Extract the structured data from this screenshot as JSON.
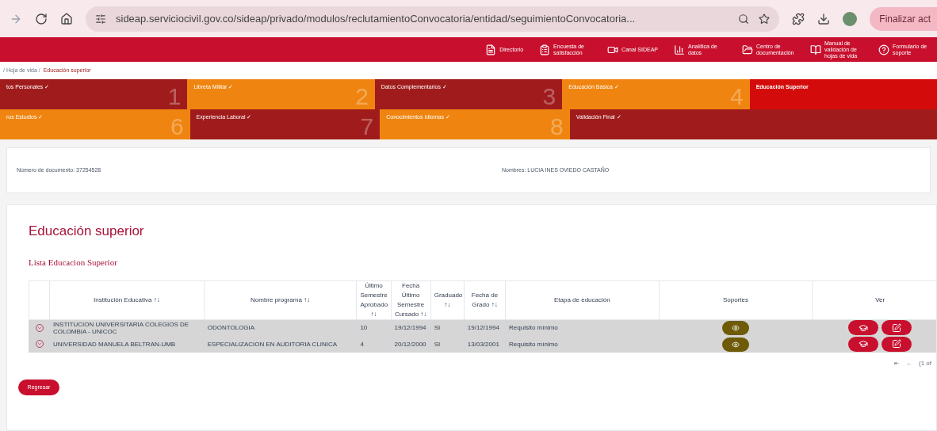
{
  "browser": {
    "url": "sideap.serviciocivil.gov.co/sideap/privado/modulos/reclutamientoConvocatoria/entidad/seguimientoConvocatoria...",
    "action": "Finalizar act"
  },
  "nav": [
    "Directorio",
    "Encuesta de satisfacción",
    "Canal SIDEAP",
    "Analítica de datos",
    "Centro de documentación",
    "Manual de validación de hojas de vida",
    "Formulario de soporte"
  ],
  "breadcrumb": [
    "/ Hoja de vida /",
    "Educación superior"
  ],
  "steps": [
    [
      {
        "label": "tos Personales ✓",
        "number": "1",
        "color": "#a01c1c",
        "selected": false
      },
      {
        "label": "Libreta Militar ✓",
        "number": "2",
        "color": "#ef8510",
        "selected": false
      },
      {
        "label": "Datos Complementarios ✓",
        "number": "3",
        "color": "#a01c1c",
        "selected": false
      },
      {
        "label": "Educación Básica ✓",
        "number": "4",
        "color": "#ef8510",
        "selected": false
      },
      {
        "label": "Educación Superior",
        "color": "#d40b0b",
        "selected": true
      }
    ],
    [
      {
        "label": "ros Estudios ✓",
        "number": "6",
        "color": "#ef8510",
        "selected": false
      },
      {
        "label": "Experiencia Laboral ✓",
        "number": "7",
        "color": "#a01c1c",
        "selected": false
      },
      {
        "label": "Conocimientos Idiomas ✓",
        "number": "8",
        "color": "#ef8510",
        "selected": false
      },
      {
        "label": "Validación Final ✓",
        "color": "#a01c1c",
        "selected": false
      }
    ]
  ],
  "info": [
    "Número de documento: 37254528",
    "Nombres: LUCIA INES OVIEDO CASTAÑO"
  ],
  "section": {
    "title": "Educación superior",
    "subtitle": "Lista Educacion Superior"
  },
  "table": {
    "columns": [
      "Institución Educativa ↑↓",
      "Nombre programa ↑↓",
      "Último Semestre Aprobado ↑↓",
      "Fecha Último Semestre Cursado ↑↓",
      "Graduado ↑↓",
      "Fecha de Grado ↑↓",
      "Etapa de educación",
      "Soportes",
      "Ver"
    ],
    "rows": [
      [
        "INSTITUCION UNIVERSITARIA COLEGIOS DE COLOMBIA - UNICOC",
        "ODONTOLOGIA",
        "10",
        "19/12/1994",
        "SI",
        "19/12/1994",
        "Requisito mínimo"
      ],
      [
        "UNIVERSIDAD MANUELA BELTRAN-UMB",
        "ESPECIALIZACION EN AUDITORIA CLINICA",
        "4",
        "20/12/2000",
        "SI",
        "13/03/2001",
        "Requisito mínimo"
      ]
    ]
  },
  "pagination": [
    "⇤",
    "←",
    "(1 of"
  ],
  "back_button": "Regresar"
}
